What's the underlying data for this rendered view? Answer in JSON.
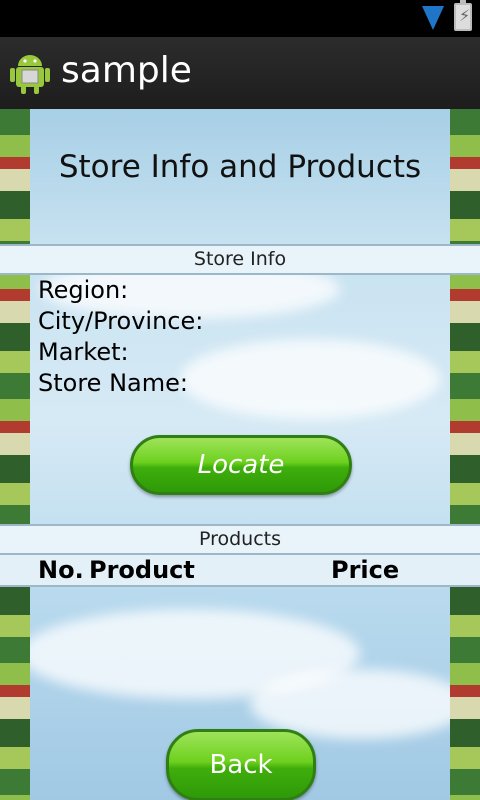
{
  "app": {
    "title": "sample"
  },
  "header": {
    "title": "Store Info and Products"
  },
  "store_info": {
    "section_label": "Store Info",
    "region_label": "Region:",
    "city_label": "City/Province:",
    "market_label": "Market:",
    "store_name_label": "Store Name:"
  },
  "buttons": {
    "locate": "Locate",
    "back": "Back"
  },
  "products": {
    "section_label": "Products",
    "columns": [
      "No.",
      "Product",
      "Price"
    ]
  },
  "colors": {
    "button_green": "#4cc214",
    "sky": "#bfe0f1"
  }
}
